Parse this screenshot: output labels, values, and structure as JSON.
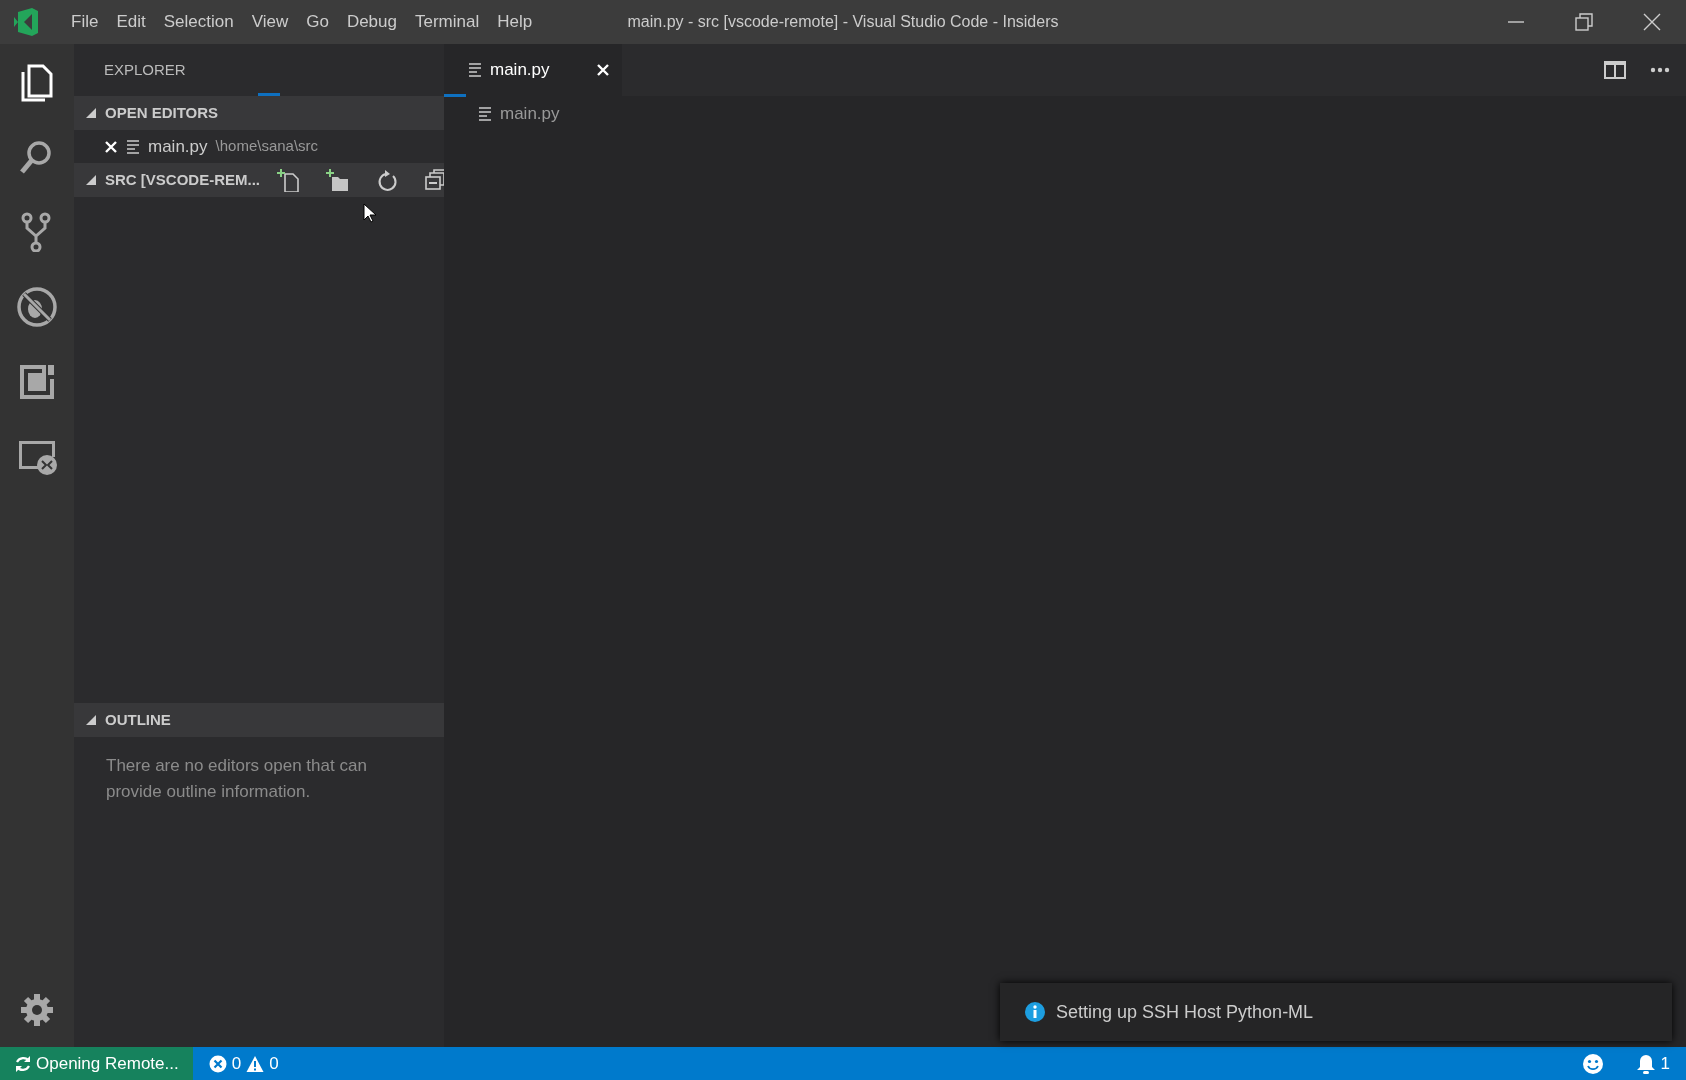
{
  "title_bar": {
    "menu": [
      "File",
      "Edit",
      "Selection",
      "View",
      "Go",
      "Debug",
      "Terminal",
      "Help"
    ],
    "title": "main.py - src [vscode-remote] - Visual Studio Code - Insiders"
  },
  "activity_bar": [
    {
      "kind": "explorer",
      "selected": true
    },
    {
      "kind": "search",
      "selected": false
    },
    {
      "kind": "scm",
      "selected": false
    },
    {
      "kind": "debug",
      "selected": false
    },
    {
      "kind": "extensions",
      "selected": false
    },
    {
      "kind": "remote",
      "selected": false
    }
  ],
  "sidebar": {
    "title": "EXPLORER",
    "loading": true,
    "sections": [
      {
        "kind": "open_editors",
        "title": "OPEN EDITORS",
        "expanded": true,
        "items": [
          {
            "name": "main.py",
            "path": "\\home\\sana\\src"
          }
        ]
      },
      {
        "kind": "folder",
        "title": "SRC [VSCODE-REM...",
        "expanded": true
      },
      {
        "kind": "outline",
        "title": "OUTLINE",
        "expanded": true,
        "message": "There are no editors open that can provide outline information."
      }
    ]
  },
  "editor": {
    "loading": true,
    "tabs": [
      {
        "label": "main.py",
        "selected": true
      }
    ],
    "breadcrumb": [
      "main.py"
    ]
  },
  "notification": {
    "message": "Setting up SSH Host Python-ML"
  },
  "status_bar": {
    "remote": "Opening Remote...",
    "errors": "0",
    "warnings": "0",
    "notifications": "1"
  }
}
